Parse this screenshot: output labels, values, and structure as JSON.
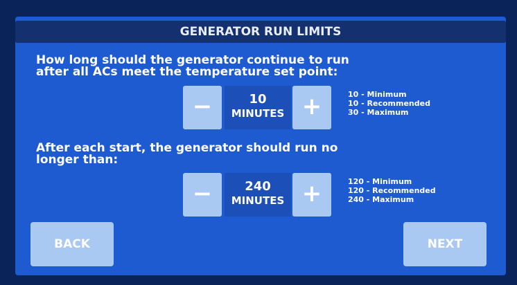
{
  "header": {
    "title": "GENERATOR RUN LIMITS"
  },
  "setting1": {
    "question_line1": "How long should the generator continue to run",
    "question_line2": "after all ACs meet the temperature set point:",
    "minus_label": "−",
    "plus_label": "+",
    "value": "10",
    "unit": "MINUTES",
    "limits": [
      "10 - Minimum",
      "10 - Recommended",
      "30 - Maximum"
    ]
  },
  "setting2": {
    "question_line1": "After each start, the generator should run no",
    "question_line2": "longer than:",
    "minus_label": "−",
    "plus_label": "+",
    "value": "240",
    "unit": "MINUTES",
    "limits": [
      "120 - Minimum",
      "120 - Recommended",
      "240 - Maximum"
    ]
  },
  "footer": {
    "back_label": "BACK",
    "next_label": "NEXT"
  },
  "colors": {
    "screen_background": "#1f5bd0",
    "title_bar": "#14306e",
    "button": "#a9c8f2",
    "value_box": "#1d4fb8"
  },
  "icons": {
    "minus": "minus-icon",
    "plus": "plus-icon"
  }
}
